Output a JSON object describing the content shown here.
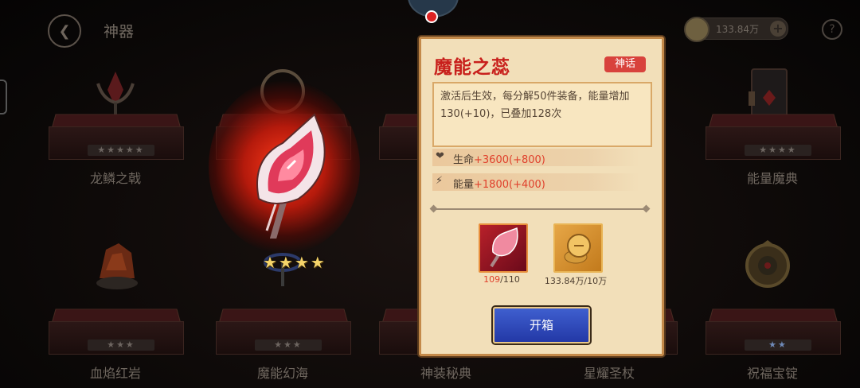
{
  "header": {
    "title": "神器",
    "currency_value": "133.84万",
    "help_label": "?"
  },
  "artifacts": [
    {
      "name": "龙鳞之戟",
      "stars": "★★★★★"
    },
    {
      "name": "",
      "stars": ""
    },
    {
      "name": "",
      "stars": ""
    },
    {
      "name": "",
      "stars": ""
    },
    {
      "name": "能量魔典",
      "stars": "★★★★"
    },
    {
      "name": "血焰红岩",
      "stars": "★★★"
    },
    {
      "name": "魔能幻海",
      "stars": "★★★"
    },
    {
      "name": "神装秘典",
      "stars": ""
    },
    {
      "name": "星耀圣杖",
      "stars": ""
    },
    {
      "name": "祝福宝锭",
      "stars": "★★"
    }
  ],
  "featured": {
    "stars": "★★★★",
    "star_count": 4
  },
  "popup": {
    "title": "魔能之蕊",
    "rarity": "神话",
    "description": "激活后生效，每分解50件装备，能量增加130(+10)，已叠加128次",
    "stats": [
      {
        "icon": "heart-icon",
        "label": "生命",
        "value": "+3600(+800)"
      },
      {
        "icon": "energy-icon",
        "label": "能量",
        "value": "+1800(+400)"
      }
    ],
    "rewards": [
      {
        "icon": "fragment-icon",
        "have": "109",
        "need": "/110"
      },
      {
        "icon": "coin-pile-icon",
        "have": "133.84万",
        "need": "/10万"
      }
    ],
    "open_button": "开箱"
  },
  "colors": {
    "accent_red": "#c8201c",
    "panel": "#f2dfb9",
    "button_blue": "#2e4bbd"
  }
}
